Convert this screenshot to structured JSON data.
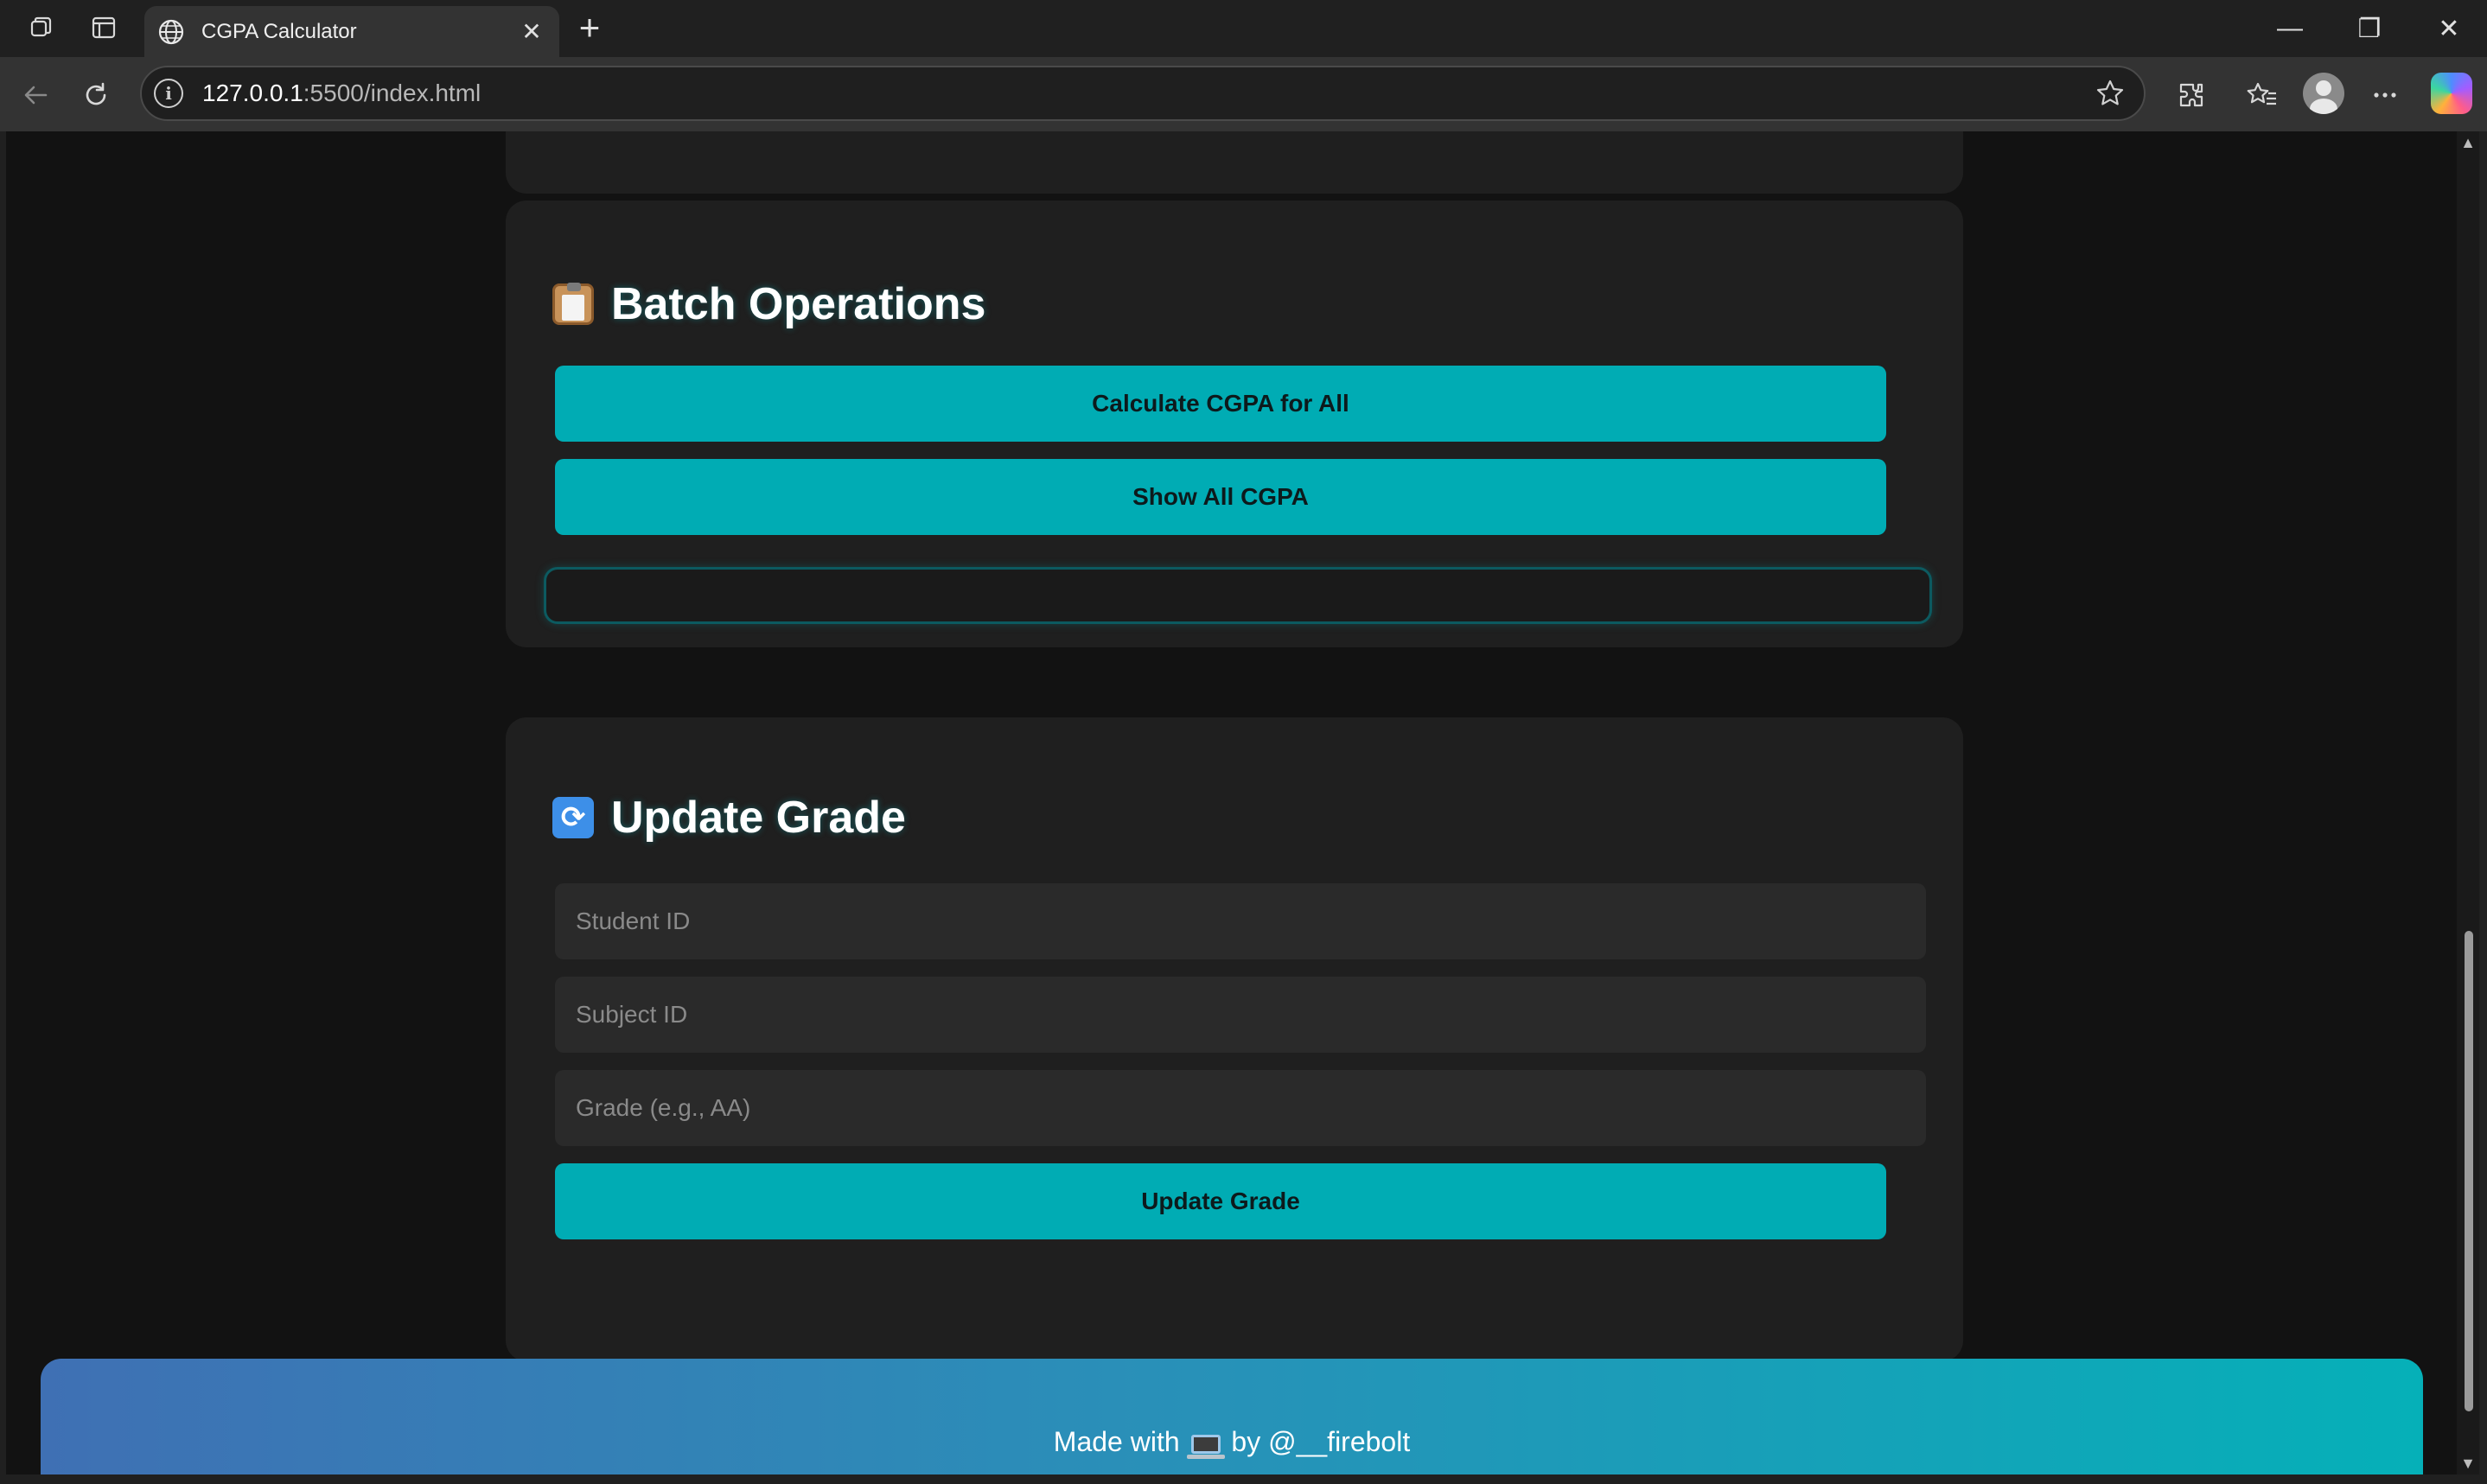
{
  "browser": {
    "tab_title": "CGPA Calculator",
    "close_tab": "✕",
    "new_tab": "+",
    "address_host": "127.0.0.1",
    "address_rest": ":5500/index.html",
    "window_controls": {
      "minimize": "—",
      "restore": "❐",
      "close": "✕"
    }
  },
  "batch_operations": {
    "title": "Batch Operations",
    "calculate_all_label": "Calculate CGPA for All",
    "show_all_label": "Show All CGPA",
    "result_text": ""
  },
  "update_grade": {
    "title": "Update Grade",
    "student_id_placeholder": "Student ID",
    "subject_id_placeholder": "Subject ID",
    "grade_placeholder": "Grade (e.g., AA)",
    "submit_label": "Update Grade"
  },
  "footer": {
    "prefix": "Made with",
    "suffix": "by @__firebolt"
  },
  "colors": {
    "accent": "#00acb4",
    "background": "#121212",
    "card": "#1f1f1f",
    "input": "#2a2a2a"
  },
  "icons": [
    "tab-actions-icon",
    "vertical-tabs-icon",
    "globe-icon",
    "back-icon",
    "refresh-icon",
    "info-icon",
    "star-icon",
    "extensions-icon",
    "favorites-icon",
    "profile-icon",
    "more-icon",
    "copilot-icon",
    "clipboard-icon",
    "refresh-arrows-icon",
    "laptop-icon"
  ]
}
